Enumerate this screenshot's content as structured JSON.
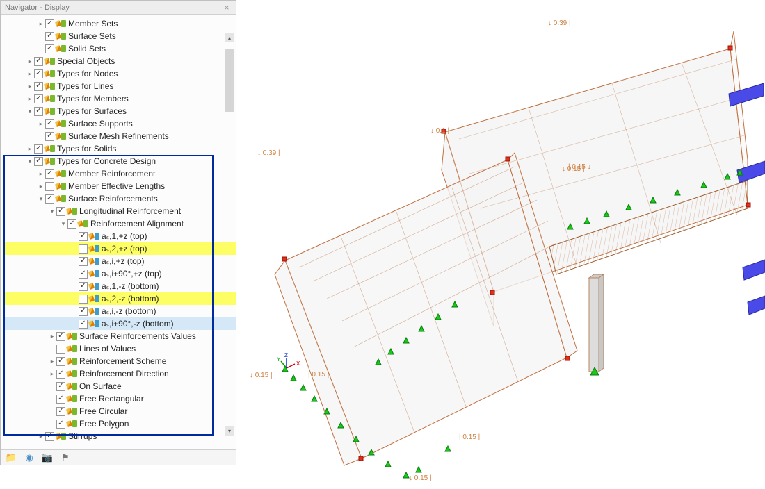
{
  "panel": {
    "title": "Navigator - Display"
  },
  "dims": {
    "a": "↓ 0.39 |",
    "b": "↓ 0.39 |",
    "c": "↓ 0.1 |",
    "d": "| 0.15 ↓",
    "e": "↓ 0.15 |",
    "f": "| 0.15 |",
    "g": "| 0.15 |",
    "h": "↓ 0.15 |",
    "i": "↓ 0.15 |"
  },
  "tree": [
    {
      "d": 3,
      "a": ">",
      "c": true,
      "l": "Member Sets"
    },
    {
      "d": 3,
      "a": "",
      "c": true,
      "l": "Surface Sets"
    },
    {
      "d": 3,
      "a": "",
      "c": true,
      "l": "Solid Sets"
    },
    {
      "d": 2,
      "a": ">",
      "c": true,
      "l": "Special Objects"
    },
    {
      "d": 2,
      "a": ">",
      "c": true,
      "l": "Types for Nodes"
    },
    {
      "d": 2,
      "a": ">",
      "c": true,
      "l": "Types for Lines"
    },
    {
      "d": 2,
      "a": ">",
      "c": true,
      "l": "Types for Members"
    },
    {
      "d": 2,
      "a": "v",
      "c": true,
      "l": "Types for Surfaces"
    },
    {
      "d": 3,
      "a": ">",
      "c": true,
      "l": "Surface Supports"
    },
    {
      "d": 3,
      "a": "",
      "c": true,
      "l": "Surface Mesh Refinements"
    },
    {
      "d": 2,
      "a": ">",
      "c": true,
      "l": "Types for Solids"
    },
    {
      "d": 2,
      "a": "v",
      "c": true,
      "l": "Types for Concrete Design"
    },
    {
      "d": 3,
      "a": ">",
      "c": true,
      "l": "Member Reinforcement"
    },
    {
      "d": 3,
      "a": ">",
      "c": false,
      "l": "Member Effective Lengths"
    },
    {
      "d": 3,
      "a": "v",
      "c": true,
      "l": "Surface Reinforcements"
    },
    {
      "d": 4,
      "a": "v",
      "c": true,
      "l": "Longitudinal Reinforcement"
    },
    {
      "d": 5,
      "a": "v",
      "c": true,
      "l": "Reinforcement Alignment"
    },
    {
      "d": 6,
      "a": "",
      "c": true,
      "alt": true,
      "l": "aₛ,1,+z (top)"
    },
    {
      "d": 6,
      "a": "",
      "c": false,
      "alt": true,
      "hl": true,
      "l": "aₛ,2,+z (top)"
    },
    {
      "d": 6,
      "a": "",
      "c": true,
      "alt": true,
      "l": "aₛ,i,+z (top)"
    },
    {
      "d": 6,
      "a": "",
      "c": true,
      "alt": true,
      "l": "aₛ,i+90°,+z (top)"
    },
    {
      "d": 6,
      "a": "",
      "c": true,
      "alt": true,
      "l": "aₛ,1,-z (bottom)"
    },
    {
      "d": 6,
      "a": "",
      "c": false,
      "alt": true,
      "hl": true,
      "l": "aₛ,2,-z (bottom)"
    },
    {
      "d": 6,
      "a": "",
      "c": true,
      "alt": true,
      "l": "aₛ,i,-z (bottom)"
    },
    {
      "d": 6,
      "a": "",
      "c": true,
      "alt": true,
      "sel": true,
      "l": "aₛ,i+90°,-z (bottom)"
    },
    {
      "d": 4,
      "a": ">",
      "c": true,
      "l": "Surface Reinforcements Values"
    },
    {
      "d": 4,
      "a": "",
      "c": false,
      "l": "Lines of Values"
    },
    {
      "d": 4,
      "a": ">",
      "c": true,
      "l": "Reinforcement Scheme"
    },
    {
      "d": 4,
      "a": ">",
      "c": true,
      "l": "Reinforcement Direction"
    },
    {
      "d": 4,
      "a": "",
      "c": true,
      "l": "On Surface"
    },
    {
      "d": 4,
      "a": "",
      "c": true,
      "l": "Free Rectangular"
    },
    {
      "d": 4,
      "a": "",
      "c": true,
      "l": "Free Circular"
    },
    {
      "d": 4,
      "a": "",
      "c": true,
      "l": "Free Polygon"
    },
    {
      "d": 3,
      "a": ">",
      "c": true,
      "l": "Stirrups"
    }
  ]
}
